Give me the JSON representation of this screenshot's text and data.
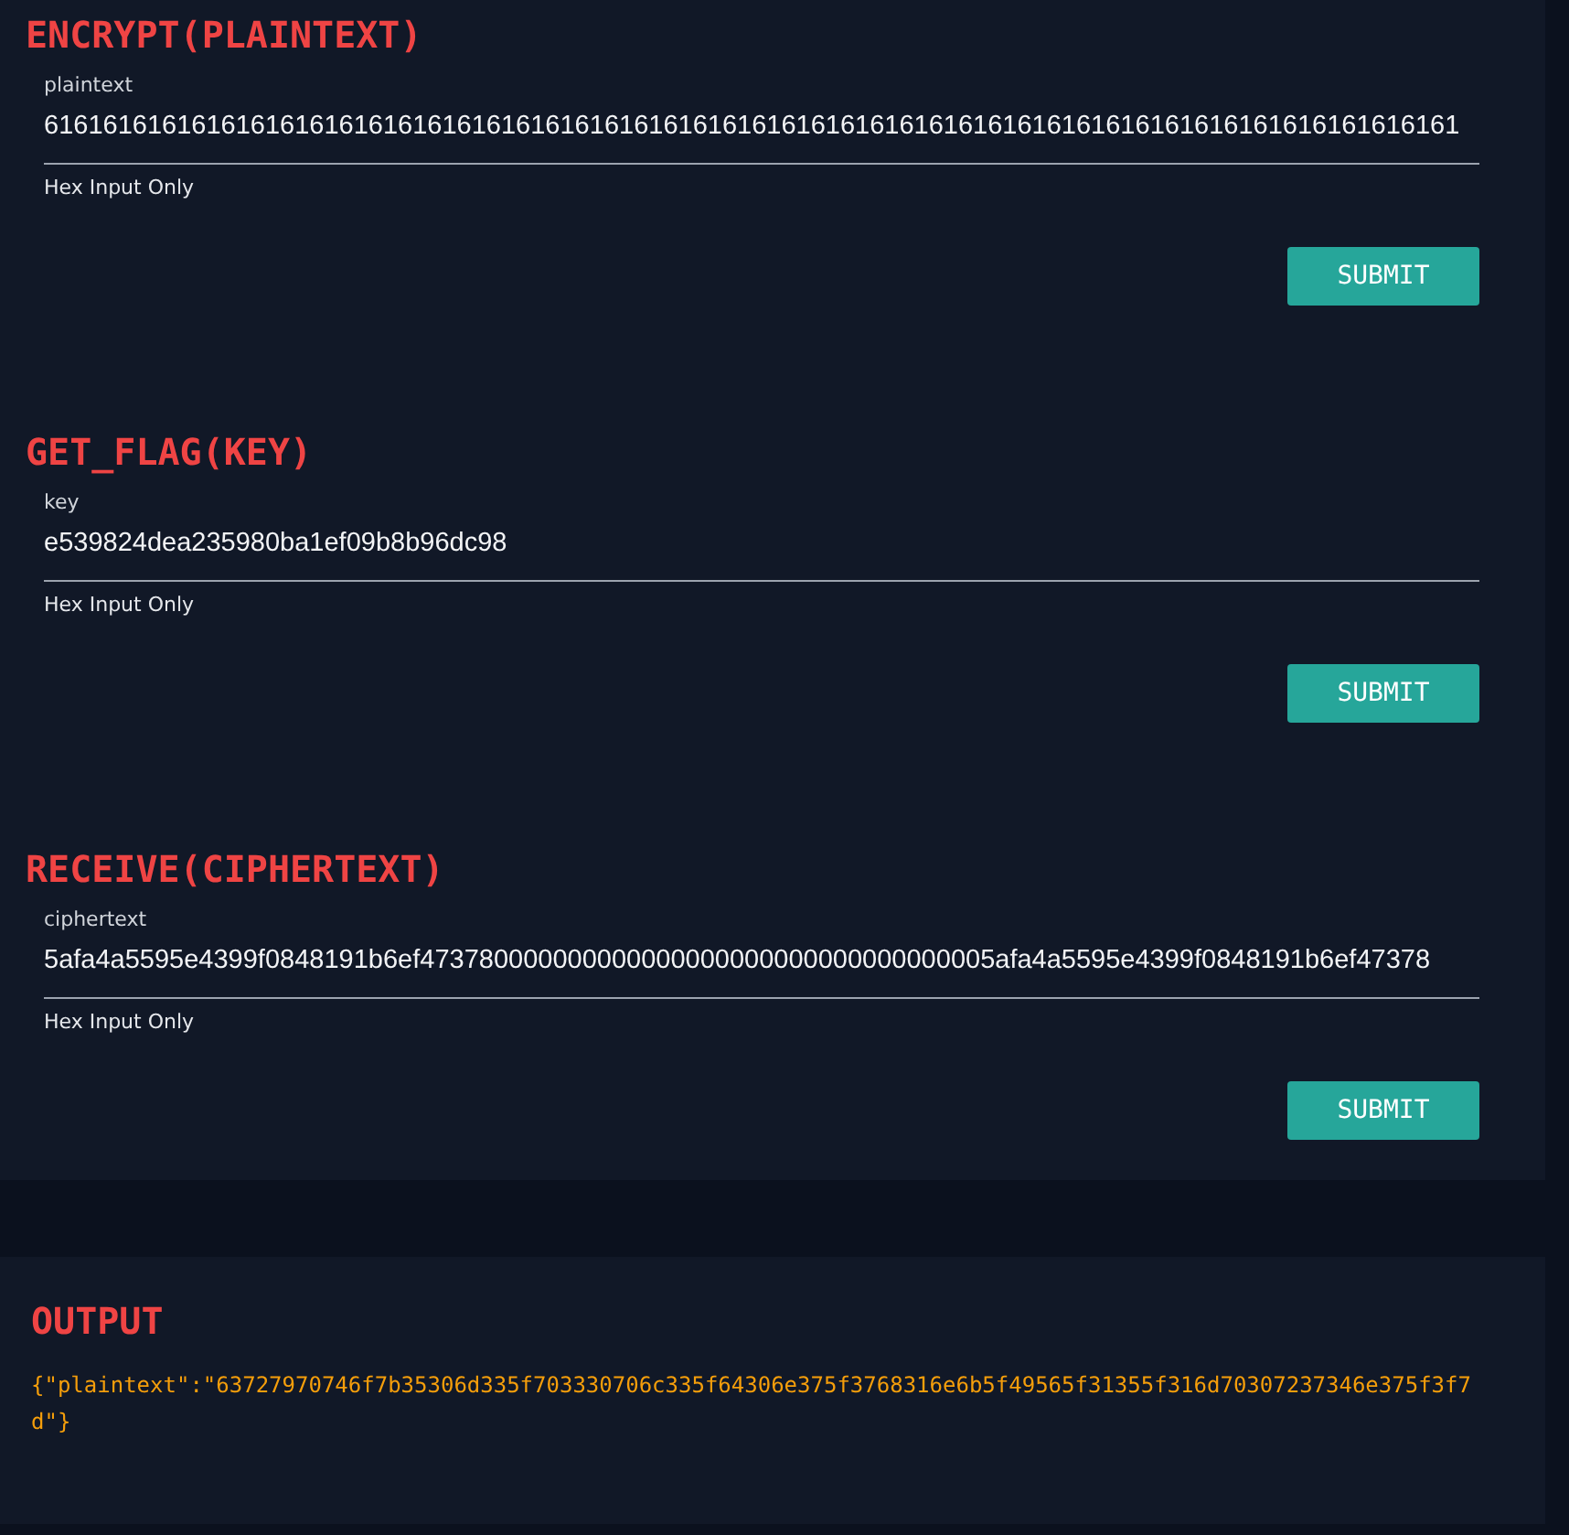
{
  "forms": [
    {
      "title": "ENCRYPT(PLAINTEXT)",
      "field_label": "plaintext",
      "value": "616161616161616161616161616161616161616161616161616161616161616161616161616161616161616161616161",
      "helper": "Hex Input Only",
      "button": "SUBMIT"
    },
    {
      "title": "GET_FLAG(KEY)",
      "field_label": "key",
      "value": "e539824dea235980ba1ef09b8b96dc98",
      "helper": "Hex Input Only",
      "button": "SUBMIT"
    },
    {
      "title": "RECEIVE(CIPHERTEXT)",
      "field_label": "ciphertext",
      "value": "5afa4a5595e4399f0848191b6ef473780000000000000000000000000000000005afa4a5595e4399f0848191b6ef47378",
      "helper": "Hex Input Only",
      "button": "SUBMIT"
    }
  ],
  "output": {
    "title": "OUTPUT",
    "text": "{\"plaintext\":\"63727970746f7b35306d335f703330706c335f64306e375f3768316e6b5f49565f31355f316d70307237346e375f3f7d\"}"
  }
}
